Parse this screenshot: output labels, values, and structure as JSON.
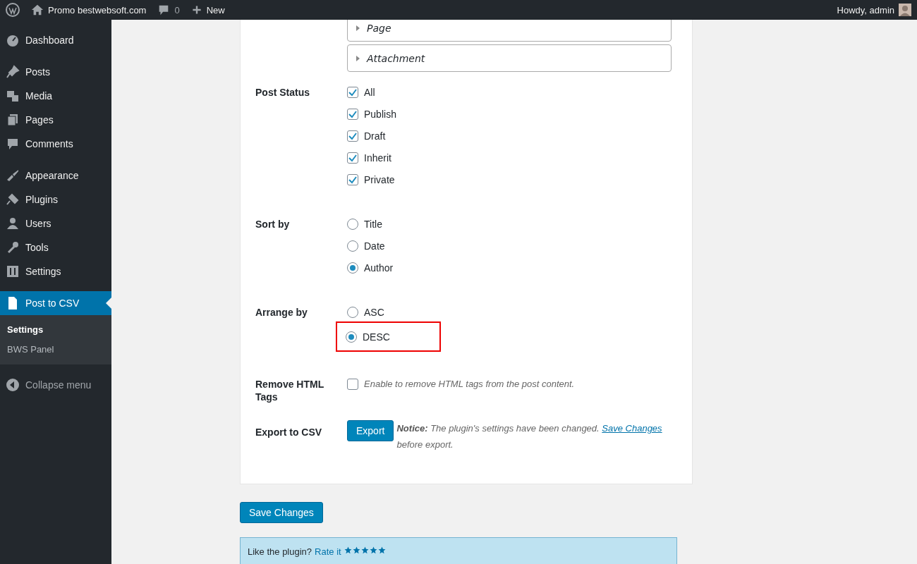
{
  "top_bar": {
    "site_name": "Promo bestwebsoft.com",
    "comments_count": "0",
    "new_label": "New",
    "greeting": "Howdy, admin"
  },
  "sidebar": {
    "groups": [
      [
        {
          "label": "Dashboard",
          "selected": false
        }
      ],
      [
        {
          "label": "Posts",
          "selected": false
        },
        {
          "label": "Media",
          "selected": false
        },
        {
          "label": "Pages",
          "selected": false
        },
        {
          "label": "Comments",
          "selected": false
        }
      ],
      [
        {
          "label": "Appearance",
          "selected": false
        },
        {
          "label": "Plugins",
          "selected": false
        },
        {
          "label": "Users",
          "selected": false
        },
        {
          "label": "Tools",
          "selected": false
        },
        {
          "label": "Settings",
          "selected": false
        }
      ],
      [
        {
          "label": "Post to CSV",
          "selected": true
        }
      ]
    ],
    "submenu": [
      {
        "label": "Settings",
        "selected": true
      },
      {
        "label": "BWS Panel",
        "selected": false
      }
    ],
    "collapse_label": "Collapse menu"
  },
  "form": {
    "post_types": [
      {
        "label": "Page",
        "expanded": false
      },
      {
        "label": "Attachment",
        "expanded": false
      }
    ],
    "rows": [
      {
        "kind": "checkboxes",
        "label": "Post Status",
        "options": [
          {
            "label": "All",
            "checked": true
          },
          {
            "label": "Publish",
            "checked": true
          },
          {
            "label": "Draft",
            "checked": true
          },
          {
            "label": "Inherit",
            "checked": true
          },
          {
            "label": "Private",
            "checked": true
          }
        ]
      },
      {
        "kind": "radios",
        "label": "Sort by",
        "options": [
          {
            "label": "Title",
            "selected": false,
            "highlighted": false
          },
          {
            "label": "Date",
            "selected": false,
            "highlighted": false
          },
          {
            "label": "Author",
            "selected": true,
            "highlighted": false
          }
        ]
      },
      {
        "kind": "radios",
        "label": "Arrange by",
        "options": [
          {
            "label": "ASC",
            "selected": false,
            "highlighted": false
          },
          {
            "label": "DESC",
            "selected": true,
            "highlighted": true
          }
        ]
      },
      {
        "kind": "toggle",
        "label": "Remove HTML Tags",
        "checked": false,
        "description": "Enable to remove HTML tags from the post content."
      },
      {
        "kind": "export",
        "label": "Export to CSV",
        "button": "Export",
        "notice_before": "**Notice:** The plugin's settings have been changed.",
        "link": "Save Changes",
        "notice_after": "before export."
      }
    ]
  },
  "save_button": "Save Changes",
  "rate_box": {
    "text": "Like the plugin?",
    "link": "Rate it",
    "stars": 5
  }
}
